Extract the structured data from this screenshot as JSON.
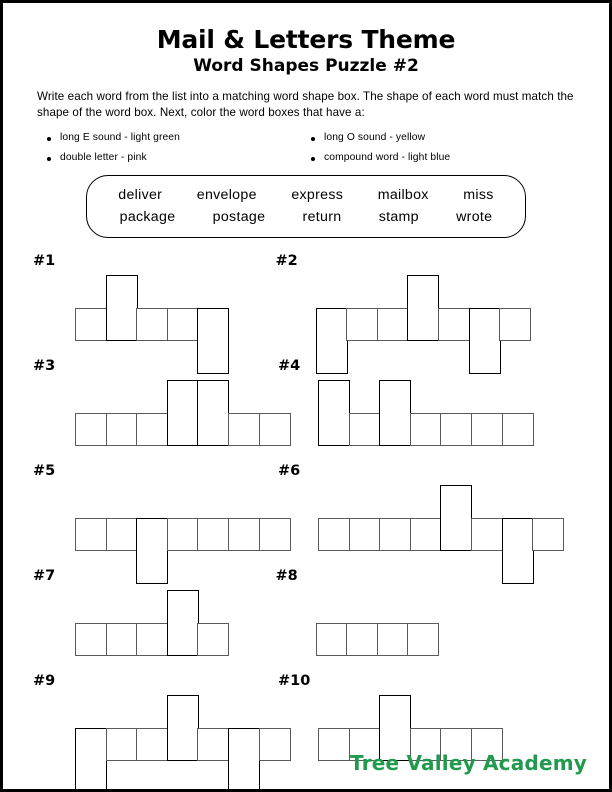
{
  "page": {
    "title_main": "Mail & Letters Theme",
    "title_sub": "Word Shapes Puzzle #2",
    "instructions": "Write each word from the list into a matching word shape box.  The shape of each word must match the shape of the word box.  Next, color the word boxes that have a:"
  },
  "color_key": [
    {
      "label": "long E sound - light green"
    },
    {
      "label": "long O sound - yellow"
    },
    {
      "label": "double letter - pink"
    },
    {
      "label": "compound word - light blue"
    }
  ],
  "word_bank": {
    "row1": [
      "deliver",
      "envelope",
      "express",
      "mailbox",
      "miss"
    ],
    "row2": [
      "package",
      "postage",
      "return",
      "stamp",
      "wrote"
    ]
  },
  "puzzles": [
    {
      "label": "#1",
      "indent": 42,
      "cells": [
        "mid",
        "tall",
        "mid",
        "mid",
        "low"
      ]
    },
    {
      "label": "#2",
      "indent": 40,
      "cells": [
        "low",
        "mid",
        "mid",
        "tall",
        "mid",
        "low",
        "mid"
      ]
    },
    {
      "label": "#3",
      "indent": 42,
      "cells": [
        "mid",
        "mid",
        "mid",
        "tall",
        "tall",
        "mid",
        "mid"
      ]
    },
    {
      "label": "#4",
      "indent": 40,
      "cells": [
        "tall",
        "mid",
        "tall",
        "mid",
        "mid",
        "mid",
        "mid"
      ]
    },
    {
      "label": "#5",
      "indent": 42,
      "cells": [
        "mid",
        "mid",
        "low",
        "mid",
        "mid",
        "mid",
        "mid"
      ]
    },
    {
      "label": "#6",
      "indent": 40,
      "cells": [
        "mid",
        "mid",
        "mid",
        "mid",
        "tall",
        "mid",
        "low",
        "mid"
      ]
    },
    {
      "label": "#7",
      "indent": 42,
      "cells": [
        "mid",
        "mid",
        "mid",
        "tall",
        "mid"
      ]
    },
    {
      "label": "#8",
      "indent": 40,
      "cells": [
        "mid",
        "mid",
        "mid",
        "mid"
      ]
    },
    {
      "label": "#9",
      "indent": 42,
      "cells": [
        "low",
        "mid",
        "mid",
        "tall",
        "mid",
        "low",
        "mid"
      ]
    },
    {
      "label": "#10",
      "indent": 40,
      "cells": [
        "mid",
        "mid",
        "tall",
        "mid",
        "mid",
        "mid"
      ]
    }
  ],
  "footer": {
    "brand": "Tree Valley Academy",
    "brand_color": "#219a4e"
  }
}
